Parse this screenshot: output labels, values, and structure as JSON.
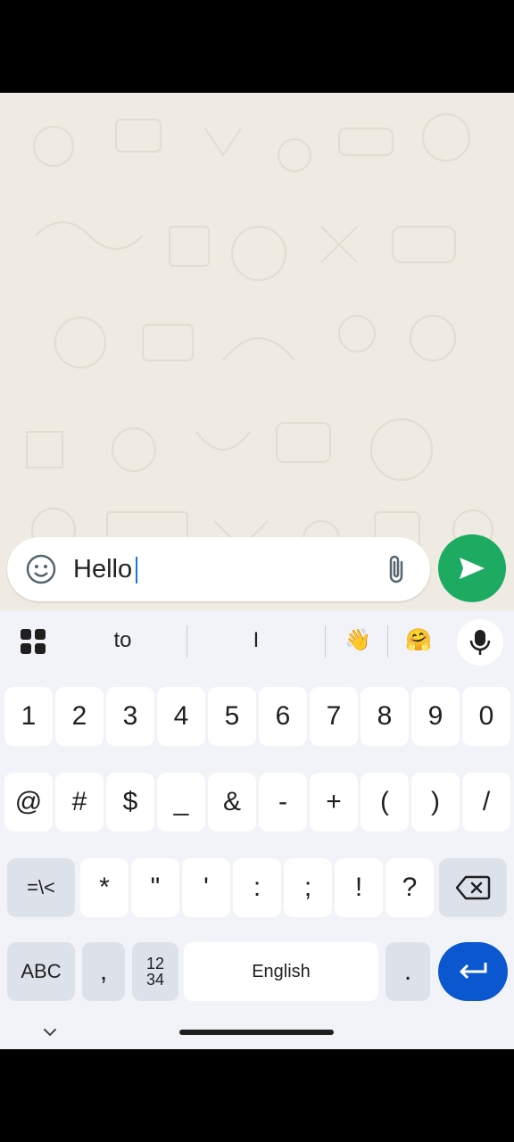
{
  "composer": {
    "message_text": "Hello",
    "icons": {
      "emoji": "sticker-icon",
      "attach": "paperclip-icon",
      "send": "send-icon"
    }
  },
  "keyboard": {
    "suggestions": {
      "word1": "to",
      "word2": "I",
      "emoji1": "👋",
      "emoji2": "🤗",
      "menu_icon": "grid-icon",
      "mic_icon": "mic-icon"
    },
    "row_numbers": [
      "1",
      "2",
      "3",
      "4",
      "5",
      "6",
      "7",
      "8",
      "9",
      "0"
    ],
    "row_symbols": [
      "@",
      "#",
      "$",
      "_",
      "&",
      "-",
      "+",
      "(",
      ")",
      "/"
    ],
    "row_third": {
      "more_symbols": "=\\<",
      "keys": [
        "*",
        "\"",
        "'",
        ":",
        ";",
        "!",
        "?"
      ],
      "backspace_icon": "backspace-icon"
    },
    "row_bottom": {
      "abc": "ABC",
      "comma": ",",
      "numpad_top": "12",
      "numpad_bottom": "34",
      "space": "English",
      "period": ".",
      "enter_icon": "enter-icon"
    },
    "hide_icon": "chevron-down-icon"
  },
  "colors": {
    "send": "#1daa61",
    "enter": "#0b57d0",
    "chat_bg": "#efeae2",
    "keyboard_bg": "#f1f3f8"
  }
}
